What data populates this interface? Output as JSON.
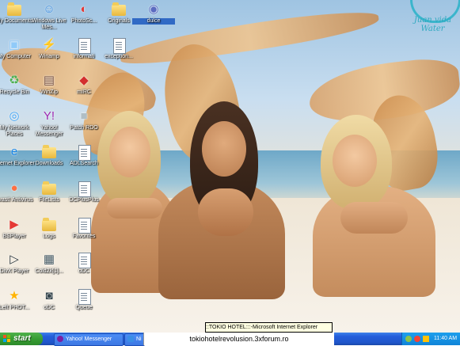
{
  "logo": {
    "text": "Juan vida Water"
  },
  "desktop_icons": [
    {
      "label": "My Documents",
      "icon": "folder-docs-icon",
      "selected": false
    },
    {
      "label": "Windows Live Mes...",
      "icon": "messenger-icon",
      "selected": false
    },
    {
      "label": "PhotoSc...",
      "icon": "photoscape-icon",
      "selected": false
    },
    {
      "label": "Originals",
      "icon": "folder-icon",
      "selected": false
    },
    {
      "label": "dulce",
      "icon": "dulce-icon",
      "selected": true
    },
    {
      "label": "My Computer",
      "icon": "computer-icon",
      "selected": false
    },
    {
      "label": "Winamp",
      "icon": "winamp-icon",
      "selected": false
    },
    {
      "label": "informati",
      "icon": "document-icon",
      "selected": false
    },
    {
      "label": "exception...",
      "icon": "document-icon",
      "selected": false
    },
    {
      "label": "Recycle Bin",
      "icon": "recycle-bin-icon",
      "selected": false
    },
    {
      "label": "WinZip",
      "icon": "winzip-icon",
      "selected": false
    },
    {
      "label": "mIRC",
      "icon": "mirc-icon",
      "selected": false
    },
    {
      "label": "My Network Places",
      "icon": "network-icon",
      "selected": false
    },
    {
      "label": "Yahoo! Messenger",
      "icon": "yahoo-icon",
      "selected": false
    },
    {
      "label": "Patch RDO",
      "icon": "patch-icon",
      "selected": false
    },
    {
      "label": "Internet Explorer",
      "icon": "ie-icon",
      "selected": false
    },
    {
      "label": "Downloads",
      "icon": "folder-icon",
      "selected": false
    },
    {
      "label": "ADLSearch",
      "icon": "document-icon",
      "selected": false
    },
    {
      "label": "avast! Antivirus",
      "icon": "avast-icon",
      "selected": false
    },
    {
      "label": "FileLists",
      "icon": "folder-icon",
      "selected": false
    },
    {
      "label": "DCPlusPlus",
      "icon": "document-icon",
      "selected": false
    },
    {
      "label": "BSPlayer",
      "icon": "bsplayer-icon",
      "selected": false
    },
    {
      "label": "Logs",
      "icon": "folder-icon",
      "selected": false
    },
    {
      "label": "Favorites",
      "icon": "document-icon",
      "selected": false
    },
    {
      "label": "DivX Player",
      "icon": "divx-icon",
      "selected": false
    },
    {
      "label": "Cold2k[1]...",
      "icon": "video-icon",
      "selected": false
    },
    {
      "label": "oDC",
      "icon": "document-icon",
      "selected": false
    },
    {
      "label": "Left PHOT...",
      "icon": "photo-icon",
      "selected": false
    },
    {
      "label": "oDC",
      "icon": "odc-icon",
      "selected": false
    },
    {
      "label": "Queue",
      "icon": "document-icon",
      "selected": false
    }
  ],
  "taskbar": {
    "start_label": "start",
    "buttons": [
      {
        "label": "Yahoo! Messenger",
        "icon": "yahoo-icon"
      },
      {
        "label": "Ni",
        "icon": "ie-icon"
      }
    ],
    "tray": {
      "time": "11:40 AM"
    }
  },
  "tooltip": "::TOKIO HOTEL:::-Microsoft Internet Explorer",
  "url_overlay": "tokiohotelrevolusion.3xforum.ro",
  "colors": {
    "taskbar": "#245edb",
    "start": "#379d33",
    "tray": "#0f84d8",
    "tooltip": "#ffffe1"
  }
}
